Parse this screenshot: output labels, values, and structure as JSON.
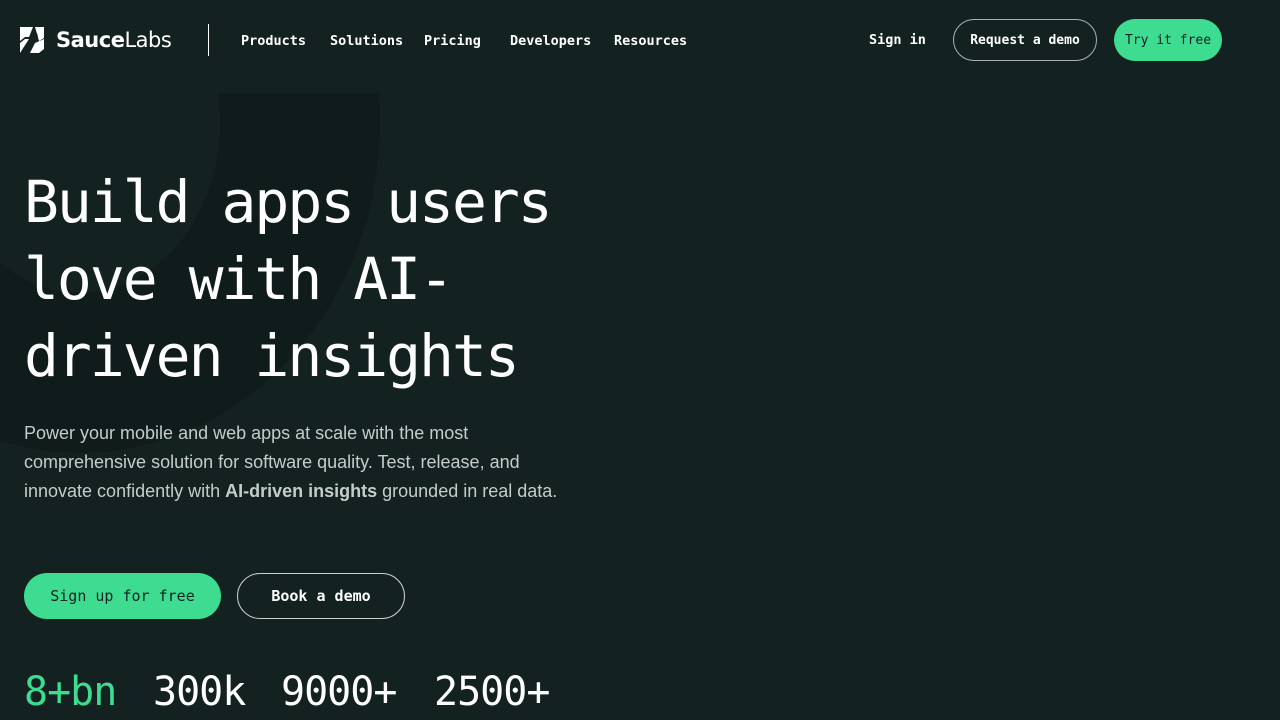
{
  "brand": {
    "logo_text_bold": "Sauce",
    "logo_text_light": "Labs",
    "accent_color": "#3ddc91",
    "background_color": "#132221"
  },
  "nav": {
    "items": [
      {
        "label": "Products"
      },
      {
        "label": "Solutions"
      },
      {
        "label": "Pricing"
      },
      {
        "label": "Developers"
      },
      {
        "label": "Resources"
      }
    ],
    "sign_in": "Sign in",
    "request_demo": "Request a demo",
    "try_free": "Try it free"
  },
  "hero": {
    "title": "Build apps users love with AI-driven insights",
    "subtitle_part1": "Power your mobile and web apps at scale with the most comprehensive solution for software quality. Test, release, and innovate confidently with ",
    "subtitle_bold": "AI-driven insights",
    "subtitle_part2": " grounded in real data.",
    "signup_label": "Sign up for free",
    "book_demo_label": "Book a demo"
  },
  "stats": [
    {
      "value": "8+bn"
    },
    {
      "value": "300k"
    },
    {
      "value": "9000+"
    },
    {
      "value": "2500+"
    }
  ]
}
